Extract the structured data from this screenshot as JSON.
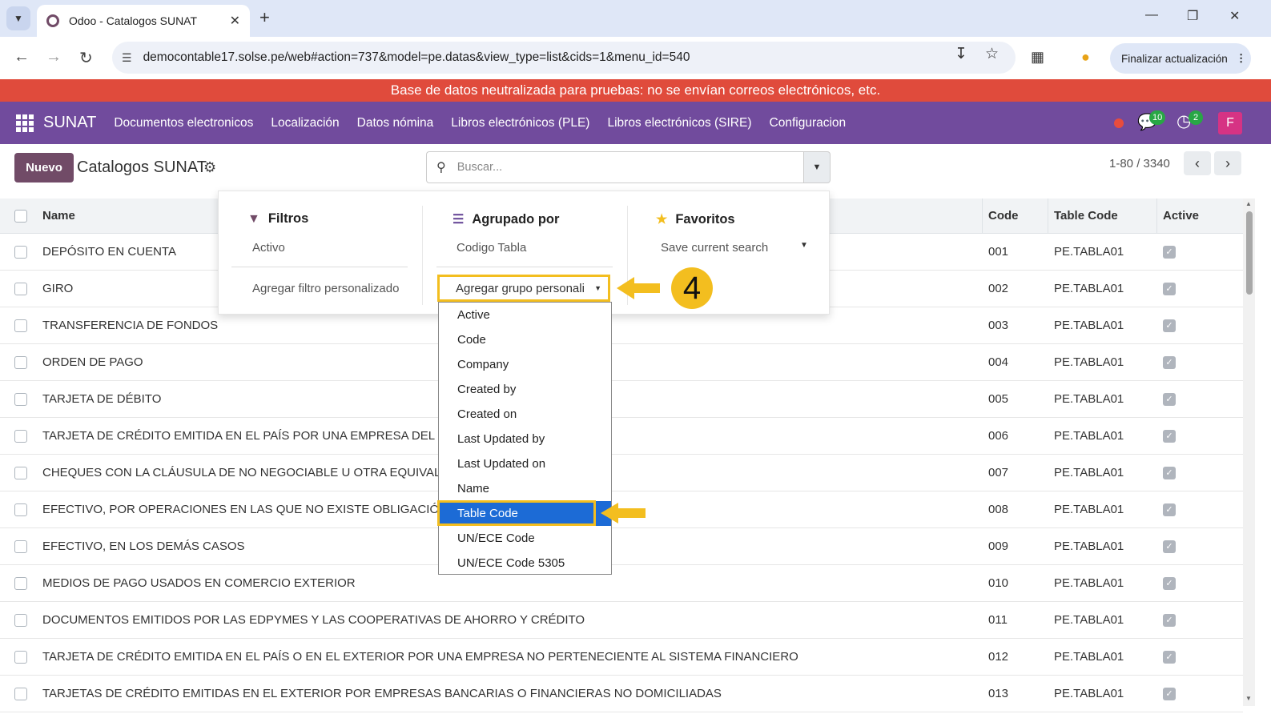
{
  "browser": {
    "tab_title": "Odoo - Catalogos SUNAT",
    "url": "democontable17.solse.pe/web#action=737&model=pe.datas&view_type=list&cids=1&menu_id=540",
    "update_button": "Finalizar actualización"
  },
  "banner": "Base de datos neutralizada para pruebas: no se envían correos electrónicos, etc.",
  "nav": {
    "brand": "SUNAT",
    "menu": [
      "Documentos electronicos",
      "Localización",
      "Datos nómina",
      "Libros electrónicos (PLE)",
      "Libros electrónicos (SIRE)",
      "Configuracion"
    ],
    "messages_badge": "10",
    "activities_badge": "2",
    "avatar_letter": "F"
  },
  "control": {
    "new_button": "Nuevo",
    "breadcrumb": "Catalogos SUNAT",
    "search_placeholder": "Buscar...",
    "pager": "1-80 / 3340"
  },
  "table": {
    "columns": [
      "Name",
      "Code",
      "Table Code",
      "Active"
    ],
    "rows": [
      {
        "name": "DEPÓSITO EN CUENTA",
        "code": "001",
        "table_code": "PE.TABLA01",
        "active": true
      },
      {
        "name": "GIRO",
        "code": "002",
        "table_code": "PE.TABLA01",
        "active": true
      },
      {
        "name": "TRANSFERENCIA DE FONDOS",
        "code": "003",
        "table_code": "PE.TABLA01",
        "active": true
      },
      {
        "name": "ORDEN DE PAGO",
        "code": "004",
        "table_code": "PE.TABLA01",
        "active": true
      },
      {
        "name": "TARJETA DE DÉBITO",
        "code": "005",
        "table_code": "PE.TABLA01",
        "active": true
      },
      {
        "name": "TARJETA DE CRÉDITO EMITIDA EN EL PAÍS POR UNA EMPRESA DEL SIS",
        "code": "006",
        "table_code": "PE.TABLA01",
        "active": true
      },
      {
        "name": "CHEQUES CON LA CLÁUSULA DE NO NEGOCIABLE U OTRA EQUIVALE",
        "code": "007",
        "table_code": "PE.TABLA01",
        "active": true
      },
      {
        "name": "EFECTIVO, POR OPERACIONES EN LAS QUE NO EXISTE OBLIGACIÓN",
        "code": "008",
        "table_code": "PE.TABLA01",
        "active": true
      },
      {
        "name": "EFECTIVO, EN LOS DEMÁS CASOS",
        "code": "009",
        "table_code": "PE.TABLA01",
        "active": true
      },
      {
        "name": "MEDIOS DE PAGO USADOS EN COMERCIO EXTERIOR",
        "code": "010",
        "table_code": "PE.TABLA01",
        "active": true
      },
      {
        "name": "DOCUMENTOS EMITIDOS POR LAS EDPYMES Y LAS COOPERATIVAS DE AHORRO Y CRÉDITO",
        "code": "011",
        "table_code": "PE.TABLA01",
        "active": true
      },
      {
        "name": "TARJETA DE CRÉDITO EMITIDA EN EL PAÍS O EN EL EXTERIOR POR UNA EMPRESA NO PERTENECIENTE AL SISTEMA FINANCIERO",
        "code": "012",
        "table_code": "PE.TABLA01",
        "active": true
      },
      {
        "name": "TARJETAS DE CRÉDITO EMITIDAS EN EL EXTERIOR POR EMPRESAS BANCARIAS O FINANCIERAS NO DOMICILIADAS",
        "code": "013",
        "table_code": "PE.TABLA01",
        "active": true
      }
    ]
  },
  "search_panel": {
    "filters": {
      "title": "Filtros",
      "items": [
        "Activo"
      ],
      "custom": "Agregar filtro personalizado"
    },
    "group_by": {
      "title": "Agrupado por",
      "items": [
        "Codigo Tabla"
      ],
      "custom_select": "Agregar grupo personali"
    },
    "favorites": {
      "title": "Favoritos",
      "save": "Save current search"
    },
    "group_options": [
      "Active",
      "Code",
      "Company",
      "Created by",
      "Created on",
      "Last Updated by",
      "Last Updated on",
      "Name",
      "Table Code",
      "UN/ECE Code",
      "UN/ECE Code 5305"
    ],
    "selected_option": "Table Code"
  },
  "annotation": {
    "step_number": "4",
    "color": "#f3be1f"
  },
  "colors": {
    "brand": "#714b9d",
    "banner": "#e04b3c",
    "primary_button": "#714b67",
    "selection": "#1c6bd6"
  }
}
